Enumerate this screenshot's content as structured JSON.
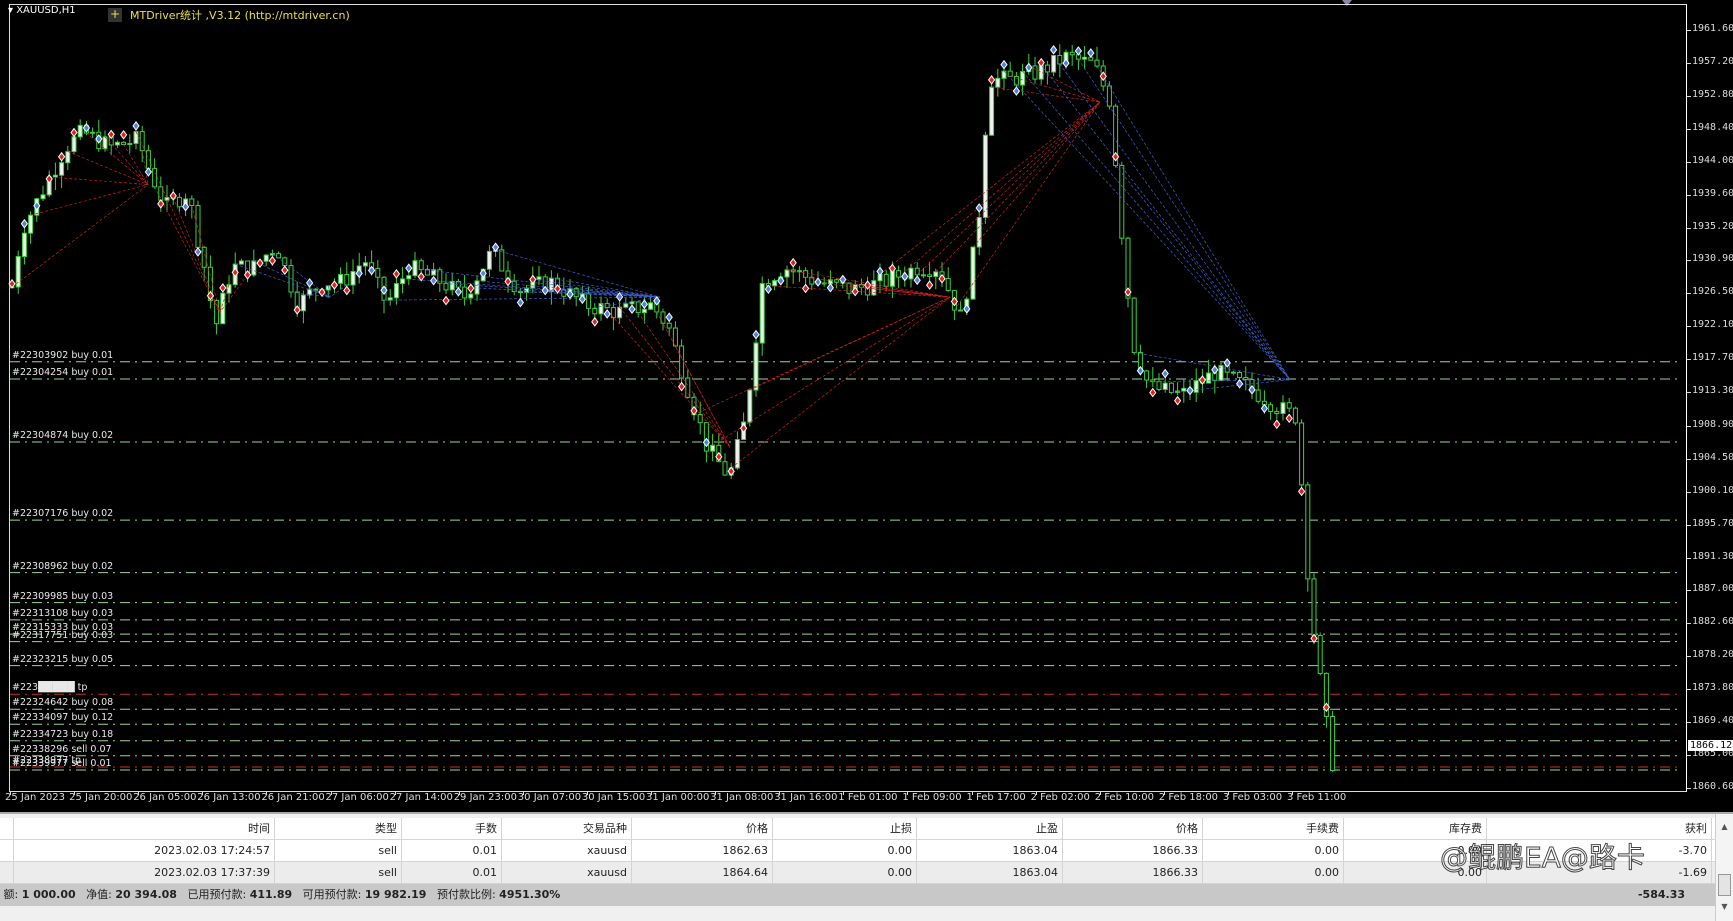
{
  "chart": {
    "symbol": "XAUUSD,H1",
    "indicator_label": "MTDriver统计 ,V3.12 (http://mtdriver.cn)",
    "indicator_button": "+",
    "current_price": "1866.12",
    "price_axis": [
      "1961.60",
      "1957.20",
      "1952.80",
      "1948.40",
      "1944.00",
      "1939.60",
      "1935.20",
      "1930.90",
      "1926.50",
      "1922.10",
      "1917.70",
      "1913.30",
      "1908.90",
      "1904.50",
      "1900.10",
      "1895.70",
      "1891.30",
      "1887.00",
      "1882.60",
      "1878.20",
      "1873.80",
      "1869.40",
      "1865.00",
      "1860.60"
    ],
    "time_axis": [
      "25 Jan 2023",
      "25 Jan 20:00",
      "26 Jan 05:00",
      "26 Jan 13:00",
      "26 Jan 21:00",
      "27 Jan 06:00",
      "27 Jan 14:00",
      "29 Jan 23:00",
      "30 Jan 07:00",
      "30 Jan 15:00",
      "31 Jan 00:00",
      "31 Jan 08:00",
      "31 Jan 16:00",
      "1 Feb 01:00",
      "1 Feb 09:00",
      "1 Feb 17:00",
      "2 Feb 02:00",
      "2 Feb 10:00",
      "2 Feb 18:00",
      "3 Feb 03:00",
      "3 Feb 11:00"
    ],
    "order_lines": [
      {
        "label": "#22303902 buy 0.01",
        "price": 1917.4,
        "color": "#9fd39f"
      },
      {
        "label": "#22304254 buy 0.01",
        "price": 1915.1,
        "color": "#9fd39f"
      },
      {
        "label": "#22304874 buy 0.02",
        "price": 1906.7,
        "color": "#9fd39f"
      },
      {
        "label": "#22307176 buy 0.02",
        "price": 1896.3,
        "color": "#9fd39f"
      },
      {
        "label": "#22308962 buy 0.02",
        "price": 1889.3,
        "color": "#9fd39f"
      },
      {
        "label": "#22309985 buy 0.03",
        "price": 1885.3,
        "color": "#9fd39f"
      },
      {
        "label": "#22313108 buy 0.03",
        "price": 1883.0,
        "color": "#9fd39f"
      },
      {
        "label": "#22315333 buy 0.03",
        "price": 1881.1,
        "color": "#9fd39f"
      },
      {
        "label": "#22317751 buy 0.03",
        "price": 1880.1,
        "color": "#9fd39f"
      },
      {
        "label": "#22323215 buy 0.05",
        "price": 1876.9,
        "color": "#9fd39f"
      },
      {
        "label": "#223█████ tp",
        "price": 1873.1,
        "color": "#c03030"
      },
      {
        "label": "#22324642 buy 0.08",
        "price": 1871.1,
        "color": "#9fd39f"
      },
      {
        "label": "#22334097 buy 0.12",
        "price": 1869.1,
        "color": "#9fd39f"
      },
      {
        "label": "#22334723 buy 0.18",
        "price": 1866.9,
        "color": "#9fd39f"
      },
      {
        "label": "#22338296 sell 0.07",
        "price": 1864.9,
        "color": "#9fd39f"
      },
      {
        "label": "#22338977 tp",
        "price": 1863.4,
        "color": "#c03030"
      },
      {
        "label": "#22339977 sell 0.01",
        "price": 1863.0,
        "color": "#9fd39f"
      }
    ]
  },
  "terminal": {
    "columns": [
      "时间",
      "类型",
      "手数",
      "交易品种",
      "价格",
      "止损",
      "止盈",
      "价格",
      "手续费",
      "库存费",
      "获利"
    ],
    "rows": [
      [
        "2023.02.03 17:24:57",
        "sell",
        "0.01",
        "xauusd",
        "1862.63",
        "0.00",
        "1863.04",
        "1866.33",
        "0.00",
        "0.00",
        "-3.70"
      ],
      [
        "2023.02.03 17:37:39",
        "sell",
        "0.01",
        "xauusd",
        "1864.64",
        "0.00",
        "1863.04",
        "1866.33",
        "0.00",
        "0.00",
        "-1.69"
      ]
    ],
    "summary": {
      "balance_label": "额:",
      "balance": "1 000.00",
      "equity_label": "净值:",
      "equity": "20 394.08",
      "margin_label": "已用预付款:",
      "margin": "411.89",
      "free_margin_label": "可用预付款:",
      "free_margin": "19 982.19",
      "margin_level_label": "预付款比例:",
      "margin_level": "4951.30%",
      "total_profit": "-584.33"
    },
    "watermark": "@鲲鹏EA@路卡"
  }
}
